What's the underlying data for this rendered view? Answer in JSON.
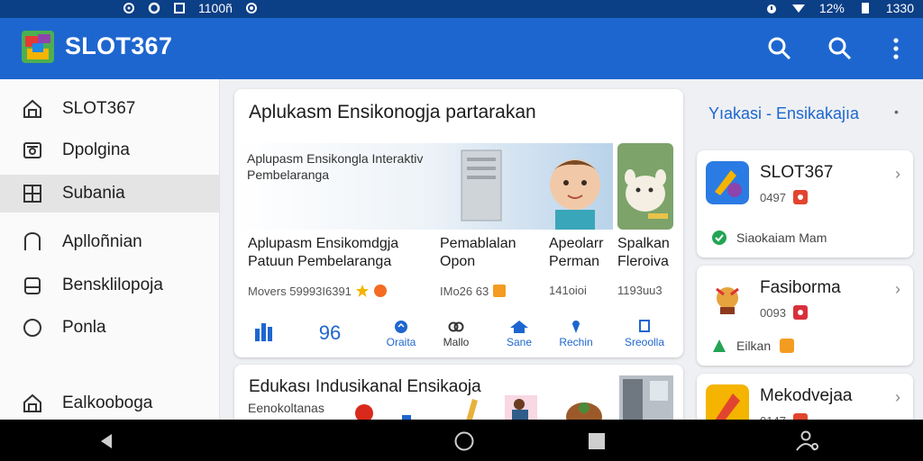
{
  "status": {
    "left_text": "1100ñ",
    "battery": "12%",
    "time": "1330"
  },
  "appbar": {
    "title": "SLOT367",
    "icons": [
      "search-icon",
      "search-icon",
      "more-vert-icon"
    ]
  },
  "drawer": {
    "items": [
      {
        "label": "SLOT367",
        "icon": "home-icon"
      },
      {
        "label": "Dpolgina",
        "icon": "camera-icon"
      },
      {
        "label": "Subania",
        "icon": "grid-icon",
        "active": true
      },
      {
        "label": "Aplloñnian",
        "icon": "bookmark-icon"
      },
      {
        "label": "Bensklilopoja",
        "icon": "box-icon"
      },
      {
        "label": "Ponla",
        "icon": "circle-icon"
      },
      {
        "label": "Ealkooboga",
        "icon": "home-icon"
      }
    ]
  },
  "main": {
    "heading": "Aplukasm Ensikonogja partarakan",
    "banner_title": "Aplupasm Ensikongla Interaktiv",
    "banner_sub": "Pembelaranga",
    "columns": [
      {
        "line1": "Aplupasm Ensikomdgja",
        "line2": "Patuun Pembelaranga"
      },
      {
        "line1": "Pemablalan",
        "line2": "Opon"
      },
      {
        "line1": "Apeolarr",
        "line2": "Perman"
      },
      {
        "line1": "Spalkan",
        "line2": "Fleroiva"
      }
    ],
    "meta": [
      "Movers 59993I6391",
      "IMo26 63",
      "141oioi",
      "1193uu3"
    ],
    "toolbar": [
      {
        "label": "",
        "icon": "chart-icon"
      },
      {
        "label": "96",
        "icon": ""
      },
      {
        "label": "Oraita",
        "icon": "globe-icon"
      },
      {
        "label": "Mallo",
        "icon": "link-icon"
      },
      {
        "label": "Sane",
        "icon": "home-icon"
      },
      {
        "label": "Rechin",
        "icon": "pin-icon"
      },
      {
        "label": "Sreoolla",
        "icon": "bookmark-icon"
      }
    ]
  },
  "main2": {
    "heading": "Edukası Indusikanal Ensikaoja",
    "sub": "Eenokoltanas"
  },
  "side": {
    "title": "Yıakasi - Ensikakajıa",
    "dot": "•",
    "cards": [
      {
        "name": "SLOT367",
        "version": "0497",
        "footer": "Siaokaiam Mam",
        "badge_color": "#e2452f"
      },
      {
        "name": "Fasiborma",
        "version": "0093",
        "footer": "Eilkan",
        "badge_color": "#d8303b"
      },
      {
        "name": "Mekodvejaa",
        "version": "0147",
        "footer": "",
        "badge_color": "#e2452f"
      }
    ]
  },
  "colors": {
    "primary": "#1e66cf",
    "status": "#0b3f86",
    "accent_orange": "#f39c21",
    "green": "#23a455"
  }
}
